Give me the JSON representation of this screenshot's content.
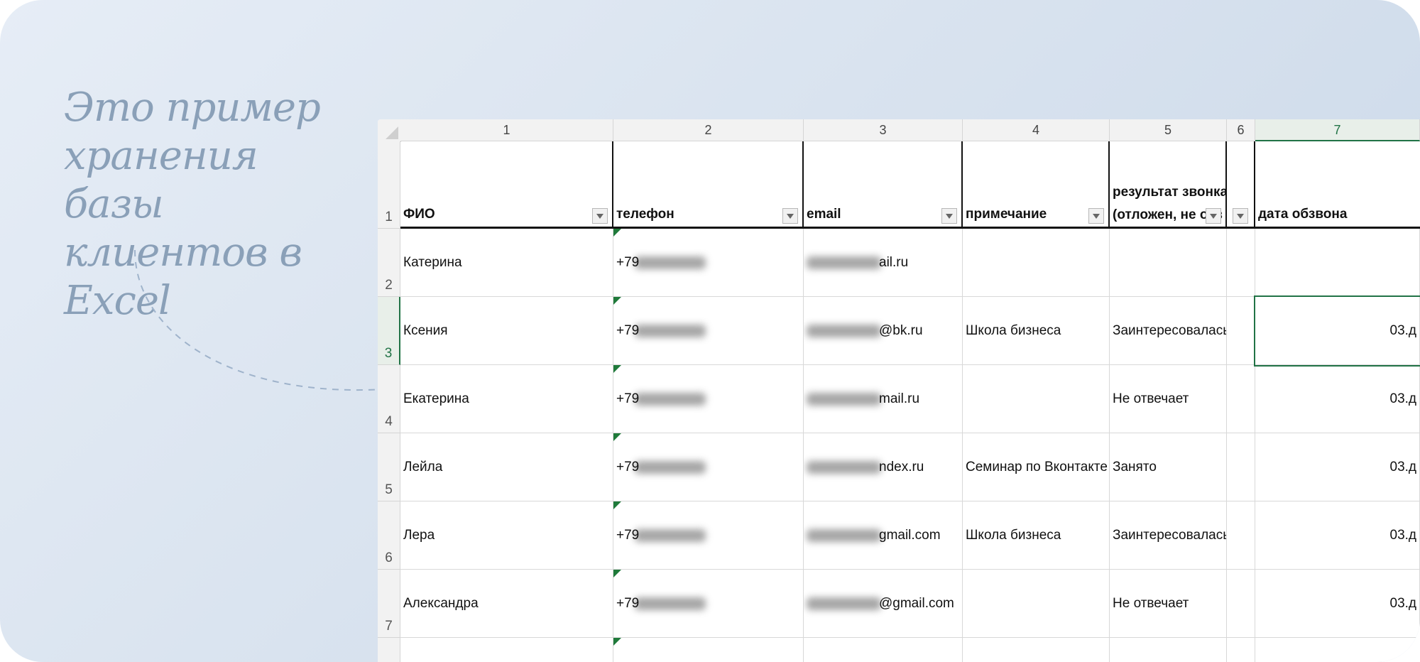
{
  "caption": {
    "line1": "Это пример",
    "line2": "хранения базы",
    "line3": "клиентов в Excel"
  },
  "sheet": {
    "column_numbers": [
      "1",
      "2",
      "3",
      "4",
      "5",
      "6",
      "7"
    ],
    "header_row_number": "1",
    "headers": {
      "fio": "ФИО",
      "phone": "телефон",
      "email": "email",
      "note": "примечание",
      "result_line1": "результат звонка",
      "result_line2": "(отложен, не отв",
      "date": "дата обзвона"
    },
    "rows": [
      {
        "num": "2",
        "fio": "Катерина",
        "phone": "+79",
        "email": "ail.ru",
        "note": "",
        "result": "",
        "date": ""
      },
      {
        "num": "3",
        "fio": "Ксения",
        "phone": "+79",
        "email": "@bk.ru",
        "note": "Школа бизнеса",
        "result": "Заинтересовалась",
        "date": "03.д"
      },
      {
        "num": "4",
        "fio": "Екатерина",
        "phone": "+79",
        "email": "mail.ru",
        "note": "",
        "result": "Не отвечает",
        "date": "03.д"
      },
      {
        "num": "5",
        "fio": "Лейла",
        "phone": "+79",
        "email": "ndex.ru",
        "note": "Семинар по Вконтакте",
        "result": "Занято",
        "date": "03.д"
      },
      {
        "num": "6",
        "fio": "Лера",
        "phone": "+79",
        "email": "gmail.com",
        "note": "Школа бизнеса",
        "result": "Заинтересовалась",
        "date": "03.д"
      },
      {
        "num": "7",
        "fio": "Александра",
        "phone": "+79",
        "email": "@gmail.com",
        "note": "",
        "result": "Не отвечает",
        "date": "03.д"
      }
    ]
  },
  "colors": {
    "accent_green": "#217346",
    "caption_blue": "#8aa0b8"
  }
}
